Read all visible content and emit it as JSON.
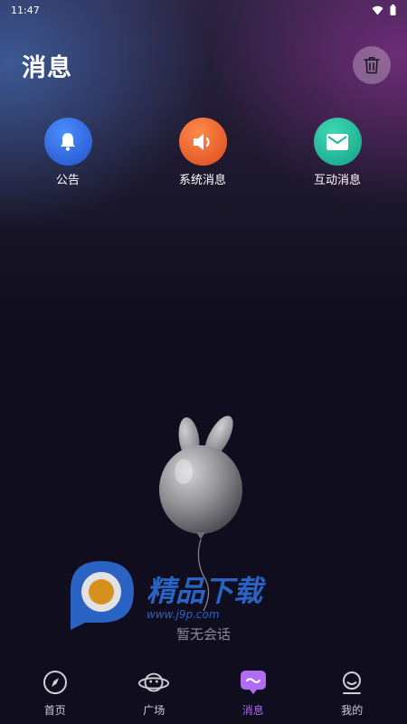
{
  "status_bar": {
    "time": "11:47"
  },
  "header": {
    "title": "消息"
  },
  "categories": [
    {
      "label": "公告",
      "icon": "bell-icon",
      "color": "#2f6ae0"
    },
    {
      "label": "系统消息",
      "icon": "speaker-icon",
      "color": "#e9632a"
    },
    {
      "label": "互动消息",
      "icon": "mail-icon",
      "color": "#21b59a"
    }
  ],
  "empty_state": {
    "text": "暂无会话",
    "illustration": "bunny-balloon"
  },
  "watermark": {
    "brand": "精品下载",
    "url": "www.j9p.com"
  },
  "tab_bar": {
    "active": "消息",
    "accent": "#b06cf2",
    "items": [
      {
        "label": "首页",
        "icon": "compass-icon"
      },
      {
        "label": "广场",
        "icon": "planet-icon"
      },
      {
        "label": "消息",
        "icon": "chat-bubble-icon"
      },
      {
        "label": "我的",
        "icon": "profile-icon"
      }
    ]
  }
}
